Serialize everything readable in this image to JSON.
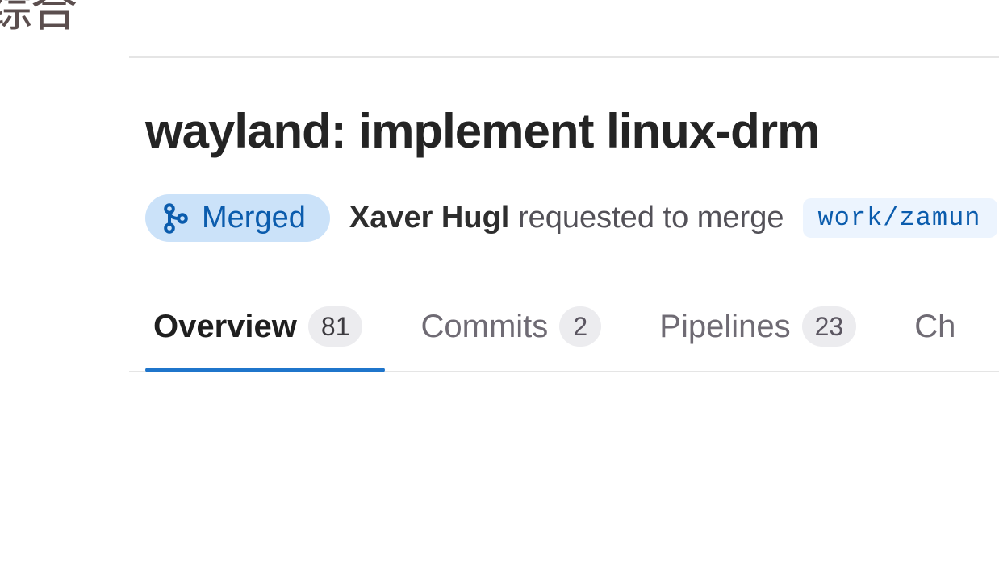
{
  "watermark": "综合",
  "mr": {
    "title": "wayland: implement linux-drm",
    "status": "Merged",
    "author": "Xaver Hugl",
    "action_text": "requested to merge",
    "source_branch": "work/zamun"
  },
  "tabs": [
    {
      "label": "Overview",
      "count": "81",
      "active": true
    },
    {
      "label": "Commits",
      "count": "2",
      "active": false
    },
    {
      "label": "Pipelines",
      "count": "23",
      "active": false
    },
    {
      "label": "Ch",
      "count": "",
      "active": false
    }
  ]
}
